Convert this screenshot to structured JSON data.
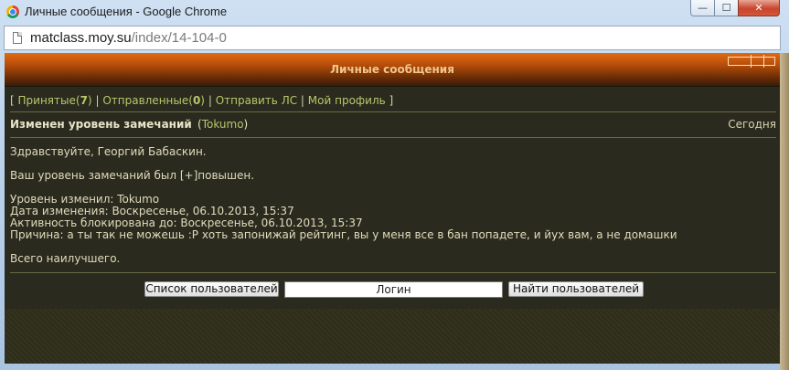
{
  "window": {
    "title": "Личные сообщения - Google Chrome",
    "url_host": "matclass.moy.su",
    "url_path": "/index/14-104-0",
    "min_glyph": "—",
    "max_glyph": "☐",
    "close_glyph": "✕"
  },
  "page": {
    "header_title": "Личные сообщения",
    "nav": {
      "open_bracket": "[",
      "close_bracket": "]",
      "sep": "|",
      "received_label": "Принятые",
      "received_count": "7",
      "sent_label": "Отправленные",
      "sent_count": "0",
      "send_label": "Отправить ЛС",
      "profile_label": "Мой профиль"
    },
    "message": {
      "subject": "Изменен уровень замечаний",
      "author": "Tokumo",
      "date": "Сегодня",
      "greeting": "Здравствуйте, Георгий Бабаскин.",
      "level_line": "Ваш уровень замечаний был [+]повышен.",
      "changed_by": "Уровень изменил: Tokumo",
      "change_date": "Дата изменения: Воскресенье, 06.10.2013, 15:37",
      "blocked_until": "Активность блокирована до: Воскресенье, 06.10.2013, 15:37",
      "reason": "Причина: а ты так не можешь :P хоть запонижай рейтинг, вы у меня все в бан попадете, и йух вам, а не домашки",
      "signoff": "Всего наилучшего."
    },
    "search": {
      "user_list_button": "Список пользователей",
      "login_value": "Логин",
      "find_button": "Найти пользователей"
    }
  }
}
